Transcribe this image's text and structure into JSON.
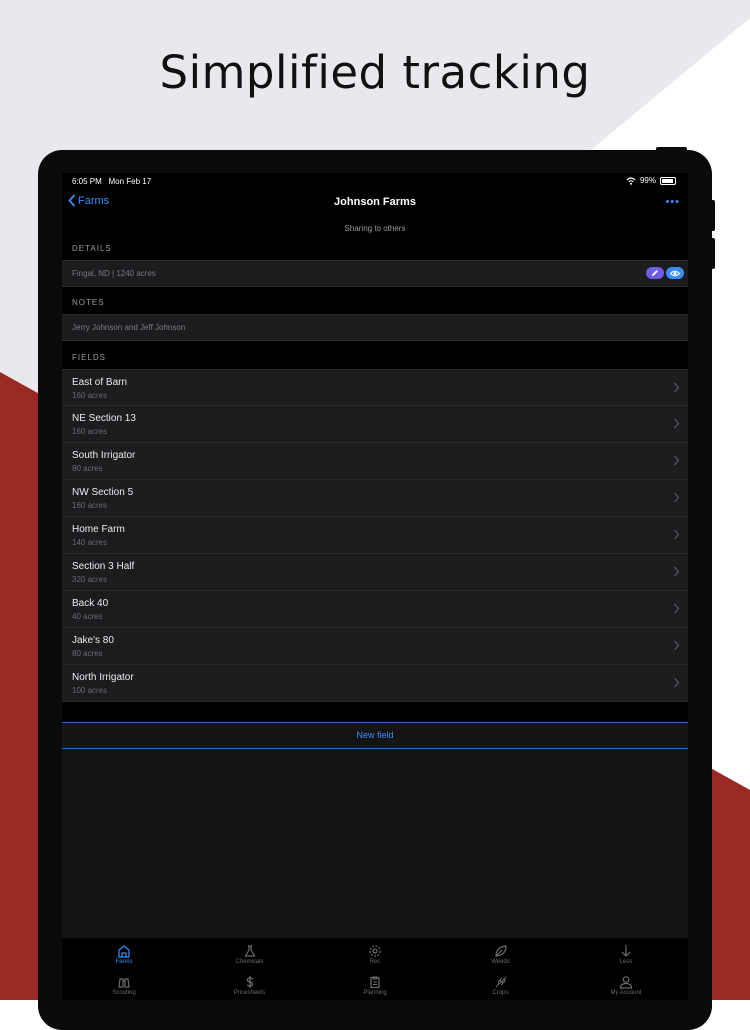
{
  "headline": "Simplified tracking",
  "status_bar": {
    "time": "6:05 PM",
    "date": "Mon Feb 17",
    "battery": "99%"
  },
  "nav": {
    "back_label": "Farms",
    "title": "Johnson Farms",
    "more_label": "•••"
  },
  "sharing_text": "Sharing to others",
  "details": {
    "label": "DETAILS",
    "value": "Fingal, ND | 1240 acres"
  },
  "notes": {
    "label": "NOTES",
    "value": "Jerry Johnson and Jeff Johnson"
  },
  "fields_label": "FIELDS",
  "fields": [
    {
      "name": "East of Barn",
      "acres": "160 acres"
    },
    {
      "name": "NE Section 13",
      "acres": "160 acres"
    },
    {
      "name": "South Irrigator",
      "acres": "80 acres"
    },
    {
      "name": "NW Section 5",
      "acres": "160 acres"
    },
    {
      "name": "Home Farm",
      "acres": "140 acres"
    },
    {
      "name": "Section 3 Half",
      "acres": "320 acres"
    },
    {
      "name": "Back 40",
      "acres": "40 acres"
    },
    {
      "name": "Jake's 80",
      "acres": "80 acres"
    },
    {
      "name": "North Irrigator",
      "acres": "100 acres"
    }
  ],
  "new_field_label": "New field",
  "tabs_row1": [
    {
      "label": "Farms",
      "icon": "farm-icon",
      "active": true
    },
    {
      "label": "Chemicals",
      "icon": "flask-icon"
    },
    {
      "label": "Rec",
      "icon": "gear-icon"
    },
    {
      "label": "Weeds",
      "icon": "leaf-icon"
    },
    {
      "label": "Less",
      "icon": "arrow-down-icon"
    }
  ],
  "tabs_row2": [
    {
      "label": "Scouting",
      "icon": "binoculars-icon"
    },
    {
      "label": "Pricesheets",
      "icon": "dollar-icon"
    },
    {
      "label": "Planning",
      "icon": "clipboard-icon"
    },
    {
      "label": "Crops",
      "icon": "wheat-icon"
    },
    {
      "label": "My Account",
      "icon": "person-icon"
    }
  ],
  "colors": {
    "accent": "#3a8dfb",
    "edit_pill": "#6f5ce5",
    "brand_red": "#9a2823",
    "panel": "#1c1c1e"
  }
}
